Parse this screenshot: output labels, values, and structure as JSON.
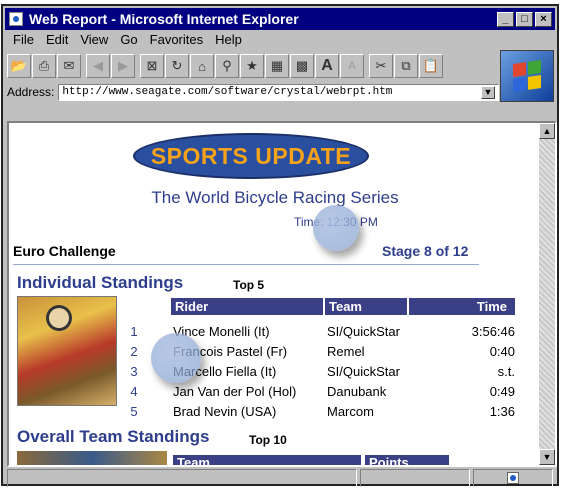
{
  "window": {
    "title": "Web Report - Microsoft Internet Explorer",
    "controls": [
      "_",
      "□",
      "×"
    ]
  },
  "menu": [
    "File",
    "Edit",
    "View",
    "Go",
    "Favorites",
    "Help"
  ],
  "toolbar": {
    "icons": [
      "open-icon",
      "print-icon",
      "mail-icon",
      "back-icon",
      "forward-icon",
      "stop-icon",
      "refresh-icon",
      "home-icon",
      "search-icon",
      "favorites-icon",
      "history-icon",
      "channels-icon",
      "font-icon",
      "font-small-icon",
      "cut-icon",
      "copy-icon",
      "paste-icon"
    ]
  },
  "address": {
    "label": "Address:",
    "value": "http://www.seagate.com/software/crystal/webrpt.htm"
  },
  "report": {
    "badge": "SPORTS UPDATE",
    "subtitle": "The World Bicycle Racing Series",
    "time_label": "Time:",
    "time_value": "12:30 PM",
    "event": "Euro Challenge",
    "stage": "Stage 8 of 12",
    "individual": {
      "title": "Individual Standings",
      "top": "Top 5",
      "headers": [
        "Rider",
        "Team",
        "Time"
      ],
      "rows": [
        {
          "rank": "1",
          "rider": "Vince Monelli (It)",
          "team": "SI/QuickStar",
          "time": "3:56:46"
        },
        {
          "rank": "2",
          "rider": "Francois Pastel (Fr)",
          "team": "Remel",
          "time": "0:40"
        },
        {
          "rank": "3",
          "rider": "Marcello Fiella (It)",
          "team": "SI/QuickStar",
          "time": "s.t."
        },
        {
          "rank": "4",
          "rider": "Jan Van der Pol (Hol)",
          "team": "Danubank",
          "time": "0:49"
        },
        {
          "rank": "5",
          "rider": "Brad Nevin (USA)",
          "team": "Marcom",
          "time": "1:36"
        }
      ]
    },
    "overall": {
      "title": "Overall Team Standings",
      "top": "Top 10",
      "headers": [
        "Team",
        "Points"
      ]
    }
  },
  "colors": {
    "accent": "#2e3e8c",
    "header_bg": "#3b3f86",
    "badge_text": "#f6a21b",
    "titlebar": "#000080"
  }
}
